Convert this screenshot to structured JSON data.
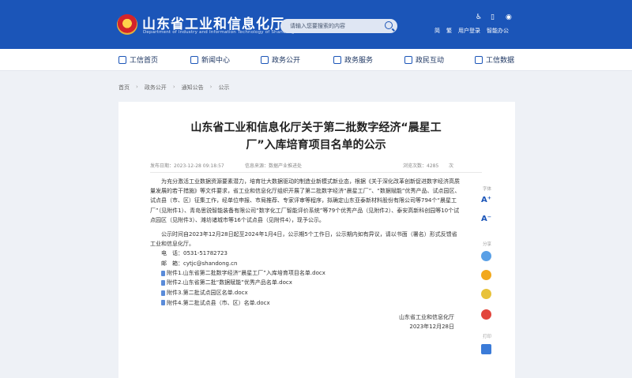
{
  "header": {
    "site_title": "山东省工业和信息化厅",
    "site_subtitle": "Department of Industry and Information Technology of Shandong Province",
    "search_placeholder": "请输入您要搜索的内容",
    "top_links": [
      "简",
      "繁",
      "用户登录",
      "智能办公"
    ]
  },
  "nav": {
    "items": [
      "工信首页",
      "新闻中心",
      "政务公开",
      "政务服务",
      "政民互动",
      "工信数据"
    ]
  },
  "breadcrumb": [
    "首页",
    "政务公开",
    "通知公告",
    "公示"
  ],
  "article": {
    "title_line1": "山东省工业和信息化厅关于第二批数字经济“晨星工",
    "title_line2": "厂”入库培育项目名单的公示",
    "meta_date": "发布日期：2023-12-28 09:18:57",
    "meta_source": "信息来源：数据产业推进处",
    "meta_views": "浏览次数：4285",
    "meta_unit": "次",
    "para1": "为充分激活工业数据资源要素潜力，培育壮大数据驱动的制造业新模式新业态，根据《关于深化改革创新促进数字经济高质量发展的若干措施》等文件要求，省工业和信息化厅组织开展了第二批数字经济“晨星工厂”、“数据赋能”优秀产品、试点园区、试点县（市、区）征集工作，经单位申报、市局推荐、专家评审等程序，拟确定山东亚泰新材料股份有限公司等794个“晨星工厂”（见附件1）、青岛思锐智能装备有限公司“数字化工厂智能评价系统”等79个优秀产品（见附件2）、泰安高新科创园等10个试点园区（见附件3）、潍坊诸城市等16个试点县（见附件4），现予公示。",
    "para2": "公示时间自2023年12月28日起至2024年1月4日，公示期5个工作日，公示期内如有异议，请以书面（署名）形式反馈省工业和信息化厅。",
    "phone": "电　话：0531-51782723",
    "email": "邮　箱：cytjc@shandong.cn",
    "attachments": [
      "附件1.山东省第二批数字经济“晨星工厂”入库培育项目名单.docx",
      "附件2.山东省第二批“数据赋能”优秀产品名单.docx",
      "附件3.第二批试点园区名单.docx",
      "附件4.第二批试点县（市、区）名单.docx"
    ],
    "signature_org": "山东省工业和信息化厅",
    "signature_date": "2023年12月28日"
  },
  "side": {
    "font_label": "字体",
    "share_label": "分享",
    "print_label": "打印"
  }
}
